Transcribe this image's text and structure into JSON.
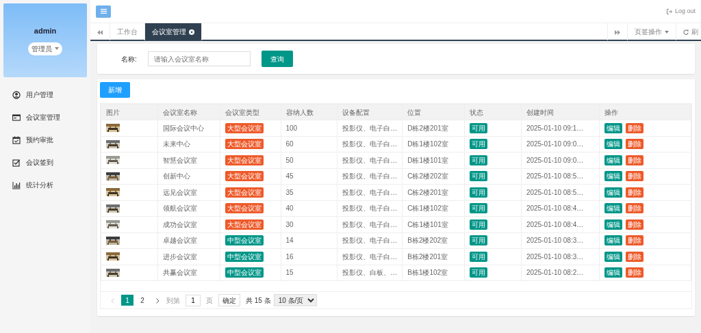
{
  "sidebar": {
    "user": "admin",
    "role": "管理员",
    "items": [
      {
        "label": "用户管理"
      },
      {
        "label": "会议室管理"
      },
      {
        "label": "预约审批"
      },
      {
        "label": "会议签到"
      },
      {
        "label": "统计分析"
      }
    ]
  },
  "header": {
    "logout": "Log out"
  },
  "tabs": [
    {
      "label": "工作台",
      "selected": false,
      "closable": false
    },
    {
      "label": "会议室管理",
      "selected": true,
      "closable": true
    }
  ],
  "tab_actions": {
    "menu": "页签操作",
    "refresh": "刷"
  },
  "search": {
    "label": "名称:",
    "placeholder": "请输入会议室名称",
    "button": "查询"
  },
  "add_button": "新增",
  "table": {
    "columns": [
      "图片",
      "会议室名称",
      "会议室类型",
      "容纳人数",
      "设备配置",
      "位置",
      "状态",
      "创建时间",
      "操作"
    ],
    "rows": [
      {
        "name": "国际会议中心",
        "type": {
          "label": "大型会议室",
          "color": "#ee5a2a"
        },
        "capacity": "100",
        "equipment": "投影仪、电子白…",
        "location": "D栋2楼201室",
        "status": "可用",
        "created": "2025-01-10 09:1…",
        "actions": [
          "编辑",
          "删除"
        ]
      },
      {
        "name": "未来中心",
        "type": {
          "label": "大型会议室",
          "color": "#ee5a2a"
        },
        "capacity": "60",
        "equipment": "投影仪、电子白…",
        "location": "D栋1楼102室",
        "status": "可用",
        "created": "2025-01-10 09:0…",
        "actions": [
          "编辑",
          "删除"
        ]
      },
      {
        "name": "智慧会议室",
        "type": {
          "label": "大型会议室",
          "color": "#ee5a2a"
        },
        "capacity": "50",
        "equipment": "投影仪、电子白…",
        "location": "D栋1楼101室",
        "status": "可用",
        "created": "2025-01-10 09:0…",
        "actions": [
          "编辑",
          "删除"
        ]
      },
      {
        "name": "创新中心",
        "type": {
          "label": "大型会议室",
          "color": "#ee5a2a"
        },
        "capacity": "45",
        "equipment": "投影仪、电子白…",
        "location": "C栋2楼202室",
        "status": "可用",
        "created": "2025-01-10 08:5…",
        "actions": [
          "编辑",
          "删除"
        ]
      },
      {
        "name": "远见会议室",
        "type": {
          "label": "大型会议室",
          "color": "#ee5a2a"
        },
        "capacity": "35",
        "equipment": "投影仪、电子白…",
        "location": "C栋2楼201室",
        "status": "可用",
        "created": "2025-01-10 08:5…",
        "actions": [
          "编辑",
          "删除"
        ]
      },
      {
        "name": "领航会议室",
        "type": {
          "label": "大型会议室",
          "color": "#ee5a2a"
        },
        "capacity": "40",
        "equipment": "投影仪、电子白…",
        "location": "C栋1楼102室",
        "status": "可用",
        "created": "2025-01-10 08:4…",
        "actions": [
          "编辑",
          "删除"
        ]
      },
      {
        "name": "成功会议室",
        "type": {
          "label": "大型会议室",
          "color": "#ee5a2a"
        },
        "capacity": "30",
        "equipment": "投影仪、电子白…",
        "location": "C栋1楼101室",
        "status": "可用",
        "created": "2025-01-10 08:4…",
        "actions": [
          "编辑",
          "删除"
        ]
      },
      {
        "name": "卓越会议室",
        "type": {
          "label": "中型会议室",
          "color": "#009688"
        },
        "capacity": "14",
        "equipment": "投影仪、电子白…",
        "location": "B栋2楼202室",
        "status": "可用",
        "created": "2025-01-10 08:3…",
        "actions": [
          "编辑",
          "删除"
        ]
      },
      {
        "name": "进步会议室",
        "type": {
          "label": "中型会议室",
          "color": "#009688"
        },
        "capacity": "16",
        "equipment": "投影仪、电子白…",
        "location": "B栋2楼201室",
        "status": "可用",
        "created": "2025-01-10 08:3…",
        "actions": [
          "编辑",
          "删除"
        ]
      },
      {
        "name": "共赢会议室",
        "type": {
          "label": "中型会议室",
          "color": "#009688"
        },
        "capacity": "15",
        "equipment": "投影仪、白板、…",
        "location": "B栋1楼102室",
        "status": "可用",
        "created": "2025-01-10 08:2…",
        "actions": [
          "编辑",
          "删除"
        ]
      }
    ]
  },
  "pagination": {
    "pages": [
      {
        "label": "1",
        "selected": true
      },
      {
        "label": "2",
        "selected": false
      }
    ],
    "goto_label": "到第",
    "goto_value": "1",
    "page_unit": "页",
    "confirm": "确定",
    "total": "共 15 条",
    "page_size": "10 条/页"
  }
}
